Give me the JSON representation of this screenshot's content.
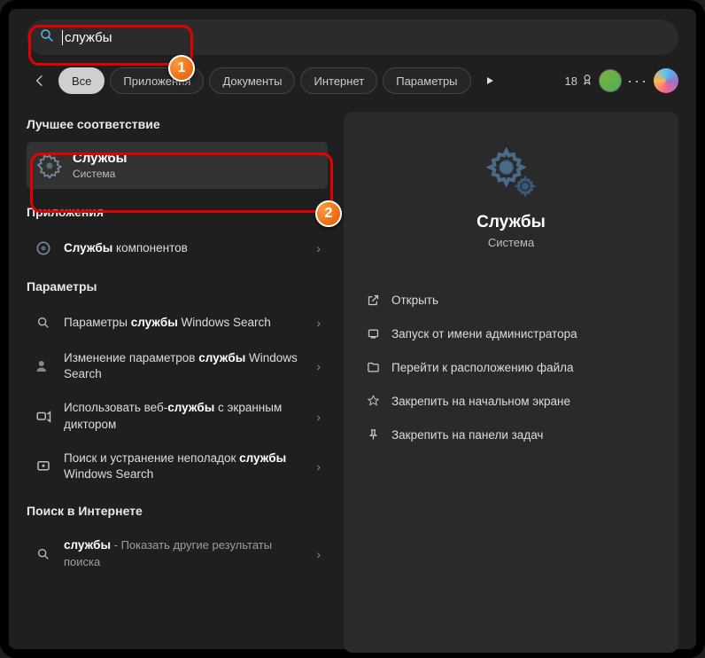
{
  "search": {
    "value": "службы"
  },
  "filters": {
    "all": "Все",
    "apps": "Приложения",
    "docs": "Документы",
    "web": "Интернет",
    "settings": "Параметры"
  },
  "points": "18",
  "sections": {
    "best_match": "Лучшее соответствие",
    "apps": "Приложения",
    "settings": "Параметры",
    "web": "Поиск в Интернете"
  },
  "best": {
    "title": "Службы",
    "subtitle": "Система"
  },
  "app_rows": [
    {
      "prefix": "Службы",
      "rest": " компонентов"
    }
  ],
  "setting_rows": [
    {
      "html": "Параметры <b>службы</b> Windows Search"
    },
    {
      "html": "Изменение параметров <b>службы</b> Windows Search"
    },
    {
      "html": "Использовать веб-<b>службы</b> с экранным диктором"
    },
    {
      "html": "Поиск и устранение неполадок <b>службы</b> Windows Search"
    }
  ],
  "web_rows": [
    {
      "main_html": "<b>службы</b>",
      "sub": " - Показать другие результаты поиска"
    }
  ],
  "right": {
    "title": "Службы",
    "subtitle": "Система",
    "actions": [
      "Открыть",
      "Запуск от имени администратора",
      "Перейти к расположению файла",
      "Закрепить на начальном экране",
      "Закрепить на панели задач"
    ]
  },
  "annotations": {
    "one": "1",
    "two": "2"
  }
}
